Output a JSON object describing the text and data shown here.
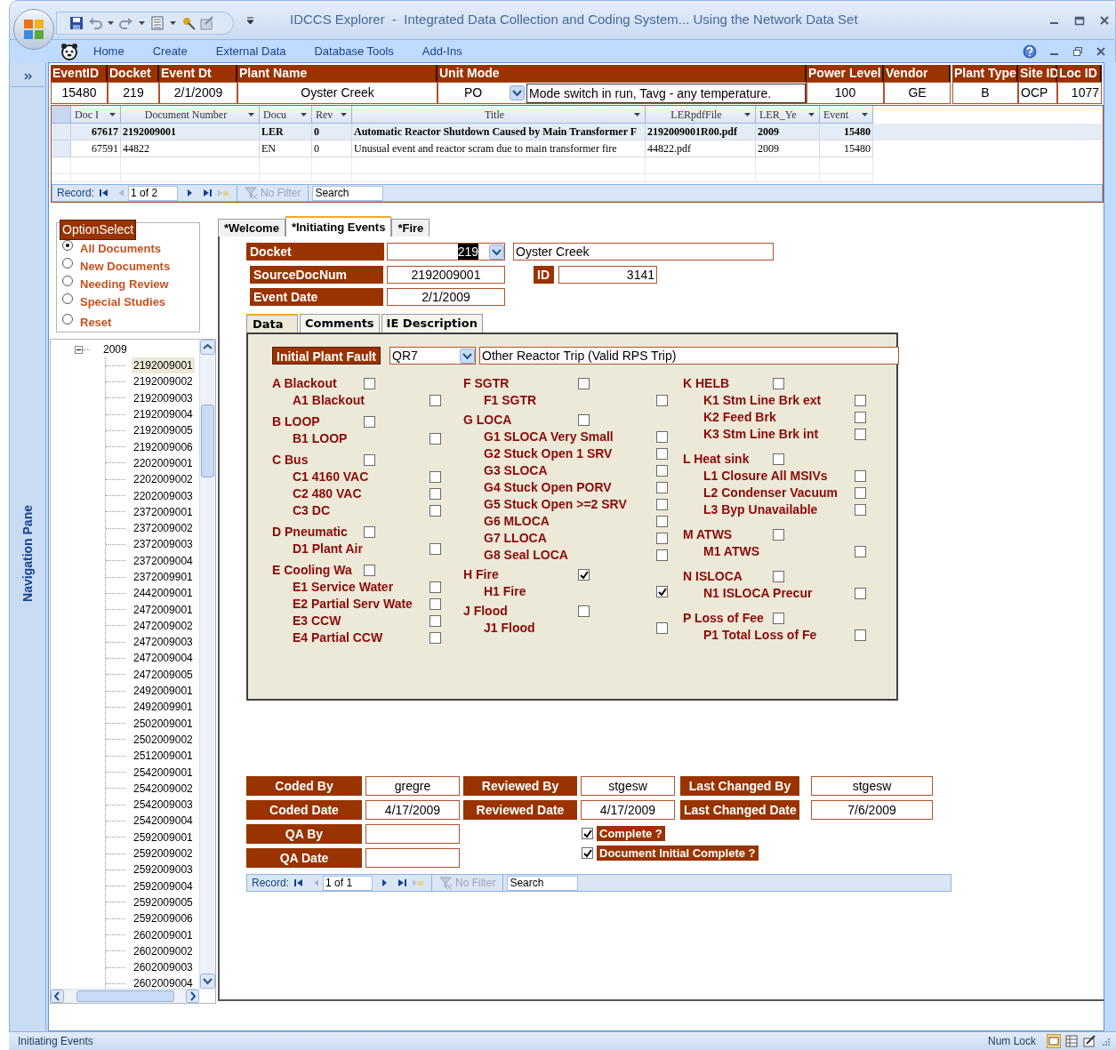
{
  "window": {
    "title": "IDCCS Explorer  -  Integrated Data Collection and Coding System... Using the Network Data Set"
  },
  "ribbon_tabs": [
    "Home",
    "Create",
    "External Data",
    "Database Tools",
    "Add-Ins"
  ],
  "navigation_pane": {
    "label": "Navigation Pane"
  },
  "header_fields": [
    {
      "label": "EventID",
      "value": "15480"
    },
    {
      "label": "Docket",
      "value": "219"
    },
    {
      "label": "Event Dt",
      "value": "2/1/2009"
    },
    {
      "label": "Plant Name",
      "value": "Oyster Creek"
    },
    {
      "label": "Unit Mode",
      "value": "PO",
      "kind": "combo",
      "description": "Mode switch in run, Tavg - any temperature."
    },
    {
      "label": "Power Level",
      "value": "100"
    },
    {
      "label": "Vendor",
      "value": "GE"
    },
    {
      "label": "Plant Type",
      "value": "B"
    },
    {
      "label": "Site ID",
      "value": "OCP"
    },
    {
      "label": "Loc ID",
      "value": "1077"
    }
  ],
  "documents_grid": {
    "columns": [
      "Doc I",
      "Document Number",
      "Docu",
      "Rev",
      "Title",
      "LERpdfFile",
      "LER_Ye",
      "Event"
    ],
    "rows": [
      {
        "cells": [
          "67617",
          "2192009001",
          "LER",
          "0",
          "Automatic Reactor Shutdown Caused by Main Transformer F",
          "2192009001R00.pdf",
          "2009",
          "15480"
        ],
        "selected": true
      },
      {
        "cells": [
          "67591",
          "44822",
          "EN",
          "0",
          "Unusual event and reactor scram due to main transformer fire",
          "44822.pdf",
          "2009",
          "15480"
        ],
        "selected": false
      }
    ]
  },
  "documents_nav": {
    "label": "Record:",
    "position": "1 of 2",
    "filter": "No Filter",
    "search": "Search"
  },
  "option_select": {
    "title": "OptionSelect",
    "options": [
      {
        "label": "All Documents",
        "selected": true
      },
      {
        "label": "New Documents",
        "selected": false
      },
      {
        "label": "Needing Review",
        "selected": false
      },
      {
        "label": "Special Studies",
        "selected": false
      },
      {
        "label": "Reset",
        "selected": false
      }
    ]
  },
  "tree": {
    "label": "2009",
    "expanded": true,
    "children": [
      {
        "label": "2192009001",
        "selected": true
      },
      {
        "label": "2192009002",
        "selected": false
      },
      {
        "label": "2192009003",
        "selected": false
      },
      {
        "label": "2192009004",
        "selected": false
      },
      {
        "label": "2192009005",
        "selected": false
      },
      {
        "label": "2192009006",
        "selected": false
      },
      {
        "label": "2202009001",
        "selected": false
      },
      {
        "label": "2202009002",
        "selected": false
      },
      {
        "label": "2202009003",
        "selected": false
      },
      {
        "label": "2372009001",
        "selected": false
      },
      {
        "label": "2372009002",
        "selected": false
      },
      {
        "label": "2372009003",
        "selected": false
      },
      {
        "label": "2372009004",
        "selected": false
      },
      {
        "label": "2372009901",
        "selected": false
      },
      {
        "label": "2442009001",
        "selected": false
      },
      {
        "label": "2472009001",
        "selected": false
      },
      {
        "label": "2472009002",
        "selected": false
      },
      {
        "label": "2472009003",
        "selected": false
      },
      {
        "label": "2472009004",
        "selected": false
      },
      {
        "label": "2472009005",
        "selected": false
      },
      {
        "label": "2492009001",
        "selected": false
      },
      {
        "label": "2492009901",
        "selected": false
      },
      {
        "label": "2502009001",
        "selected": false
      },
      {
        "label": "2502009002",
        "selected": false
      },
      {
        "label": "2512009001",
        "selected": false
      },
      {
        "label": "2542009001",
        "selected": false
      },
      {
        "label": "2542009002",
        "selected": false
      },
      {
        "label": "2542009003",
        "selected": false
      },
      {
        "label": "2542009004",
        "selected": false
      },
      {
        "label": "2592009001",
        "selected": false
      },
      {
        "label": "2592009002",
        "selected": false
      },
      {
        "label": "2592009003",
        "selected": false
      },
      {
        "label": "2592009004",
        "selected": false
      },
      {
        "label": "2592009005",
        "selected": false
      },
      {
        "label": "2592009006",
        "selected": false
      },
      {
        "label": "2602009001",
        "selected": false
      },
      {
        "label": "2602009002",
        "selected": false
      },
      {
        "label": "2602009003",
        "selected": false
      },
      {
        "label": "2602009004",
        "selected": false
      }
    ]
  },
  "form_tabs": [
    {
      "label": "*Welcome",
      "selected": false
    },
    {
      "label": "*Initiating Events",
      "selected": true
    },
    {
      "label": "*Fire",
      "selected": false
    }
  ],
  "form": {
    "docket": {
      "label": "Docket",
      "value": "219",
      "highlighted": true,
      "plant": "Oyster Creek"
    },
    "source_doc": {
      "label": "SourceDocNum",
      "value": "2192009001",
      "id_label": "ID",
      "id_value": "3141"
    },
    "event_date": {
      "label": "Event Date",
      "value": "2/1/2009"
    },
    "subtabs": [
      {
        "label": "Data",
        "selected": true
      },
      {
        "label": "Comments",
        "selected": false
      },
      {
        "label": "IE Description",
        "selected": false
      }
    ],
    "initial_plant_fault": {
      "label": "Initial Plant Fault",
      "code": "QR7",
      "description": "Other Reactor Trip (Valid RPS Trip)"
    },
    "fault_columns": [
      [
        {
          "label": "A Blackout",
          "checked": false,
          "children": [
            {
              "label": "A1 Blackout",
              "checked": false
            }
          ]
        },
        {
          "label": "B LOOP",
          "checked": false,
          "children": [
            {
              "label": "B1 LOOP",
              "checked": false
            }
          ]
        },
        {
          "label": "C Bus",
          "checked": false,
          "children": [
            {
              "label": "C1 4160 VAC",
              "checked": false
            },
            {
              "label": "C2 480 VAC",
              "checked": false
            },
            {
              "label": "C3 DC",
              "checked": false
            }
          ]
        },
        {
          "label": "D Pneumatic",
          "checked": false,
          "children": [
            {
              "label": "D1 Plant Air",
              "checked": false
            }
          ]
        },
        {
          "label": "E Cooling Wa",
          "checked": false,
          "children": [
            {
              "label": "E1 Service Water",
              "checked": false
            },
            {
              "label": "E2 Partial Serv Wate",
              "checked": false
            },
            {
              "label": "E3 CCW",
              "checked": false
            },
            {
              "label": "E4 Partial CCW",
              "checked": false
            }
          ]
        }
      ],
      [
        {
          "label": "F SGTR",
          "checked": false,
          "children": [
            {
              "label": "F1 SGTR",
              "checked": false
            }
          ]
        },
        {
          "label": "G LOCA",
          "checked": false,
          "children": [
            {
              "label": "G1 SLOCA Very Small",
              "checked": false
            },
            {
              "label": "G2 Stuck Open 1 SRV",
              "checked": false
            },
            {
              "label": "G3 SLOCA",
              "checked": false
            },
            {
              "label": "G4 Stuck Open PORV",
              "checked": false
            },
            {
              "label": "G5 Stuck Open >=2 SRV",
              "checked": false
            },
            {
              "label": "G6 MLOCA",
              "checked": false
            },
            {
              "label": "G7 LLOCA",
              "checked": false
            },
            {
              "label": "G8 Seal LOCA",
              "checked": false
            }
          ]
        },
        {
          "label": "H Fire",
          "checked": true,
          "children": [
            {
              "label": "H1 Fire",
              "checked": true
            }
          ]
        },
        {
          "label": "J Flood",
          "checked": false,
          "children": [
            {
              "label": "J1 Flood",
              "checked": false
            }
          ]
        }
      ],
      [
        {
          "label": "K HELB",
          "checked": false,
          "children": [
            {
              "label": "K1 Stm Line Brk ext",
              "checked": false
            },
            {
              "label": "K2 Feed Brk",
              "checked": false
            },
            {
              "label": "K3 Stm Line Brk int",
              "checked": false
            }
          ]
        },
        {
          "label": "L Heat sink",
          "checked": false,
          "children": [
            {
              "label": "L1 Closure All MSIVs",
              "checked": false
            },
            {
              "label": "L2 Condenser Vacuum",
              "checked": false
            },
            {
              "label": "L3 Byp Unavailable",
              "checked": false
            }
          ]
        },
        {
          "label": "M ATWS",
          "checked": false,
          "children": [
            {
              "label": "M1 ATWS",
              "checked": false
            }
          ]
        },
        {
          "label": "N ISLOCA",
          "checked": false,
          "children": [
            {
              "label": "N1 ISLOCA Precur",
              "checked": false
            }
          ]
        },
        {
          "label": "P Loss of Fee",
          "checked": false,
          "children": [
            {
              "label": "P1 Total Loss of Fe",
              "checked": false
            }
          ]
        }
      ]
    ],
    "audit_rows": [
      [
        {
          "label": "Coded By",
          "value": "gregre"
        },
        {
          "label": "Reviewed By",
          "value": "stgesw"
        },
        {
          "label": "Last Changed By",
          "value": "stgesw"
        }
      ],
      [
        {
          "label": "Coded Date",
          "value": "4/17/2009"
        },
        {
          "label": "Reviewed Date",
          "value": "4/17/2009"
        },
        {
          "label": "Last Changed Date",
          "value": "7/6/2009"
        }
      ],
      [
        {
          "label": "QA By"
        }
      ],
      [
        {
          "label": "QA Date"
        }
      ]
    ],
    "completion_checks": [
      {
        "label": "Complete ?",
        "checked": true
      },
      {
        "label": "Document Initial Complete ?",
        "checked": true
      }
    ],
    "record_nav": {
      "label": "Record:",
      "position": "1 of 1",
      "filter": "No Filter",
      "search": "Search"
    }
  },
  "status_bar": {
    "text": "Initiating Events",
    "num_lock": "Num Lock"
  }
}
